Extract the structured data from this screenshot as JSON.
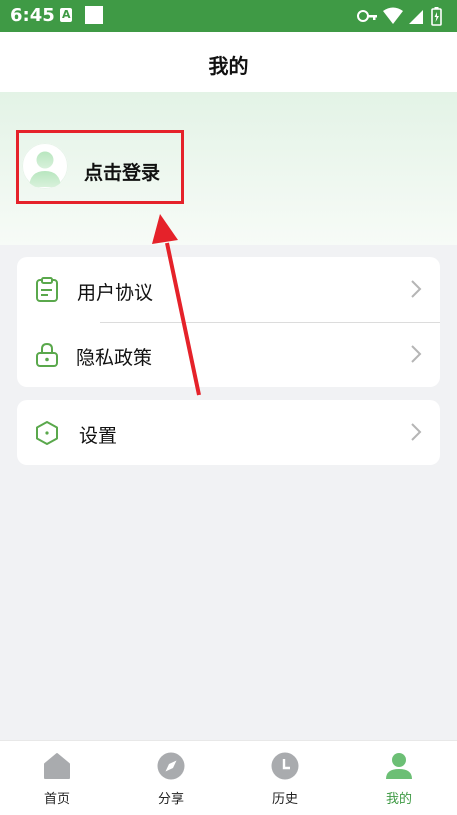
{
  "status_bar": {
    "time": "6:45",
    "a_glyph": "A"
  },
  "appbar": {
    "title": "我的"
  },
  "profile": {
    "login_label": "点击登录"
  },
  "menu": [
    {
      "label": "用户协议",
      "icon": "clipboard-icon"
    },
    {
      "label": "隐私政策",
      "icon": "lock-icon"
    }
  ],
  "settings": {
    "label": "设置",
    "icon": "hexagon-icon"
  },
  "bottom_nav": [
    {
      "label": "首页",
      "icon": "home-icon",
      "active": false
    },
    {
      "label": "分享",
      "icon": "compass-icon",
      "active": false
    },
    {
      "label": "历史",
      "icon": "clock-icon",
      "active": false
    },
    {
      "label": "我的",
      "icon": "person-icon",
      "active": true
    }
  ],
  "colors": {
    "brand": "#3f9a45",
    "annotation": "#e5222a"
  }
}
